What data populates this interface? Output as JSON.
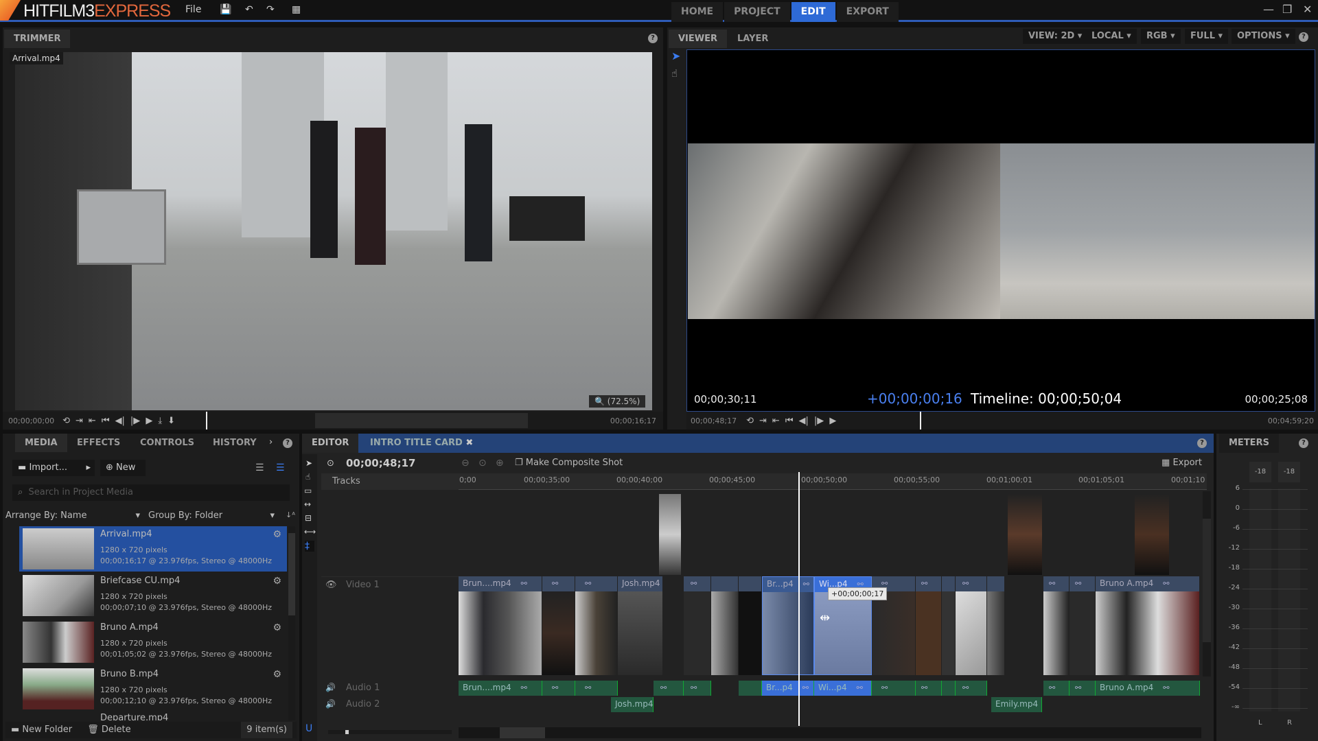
{
  "app": {
    "logo_part1": "HITFILM3",
    "logo_part2": "EXPRESS",
    "menu_file": "File",
    "mode_tabs": [
      "HOME",
      "PROJECT",
      "EDIT",
      "EXPORT"
    ],
    "active_mode": "EDIT",
    "accent": "#2e6ad6"
  },
  "trimmer": {
    "tab": "TRIMMER",
    "clip_label": "Arrival.mp4",
    "zoom": "(72.5%)",
    "timecode_in": "00;00;00;00",
    "timecode_out": "00;00;16;17"
  },
  "viewer": {
    "tabs": [
      "VIEWER",
      "LAYER"
    ],
    "options": [
      "VIEW: 2D",
      "LOCAL",
      "RGB",
      "FULL",
      "OPTIONS"
    ],
    "left_tc": "00;00;30;11",
    "offset": "+00;00;00;16",
    "timeline_tc": "Timeline: 00;00;50;04",
    "right_tc": "00;00;25;08",
    "current_tc": "00;00;48;17",
    "end_tc": "00;04;59;20"
  },
  "media": {
    "tabs": [
      "MEDIA",
      "EFFECTS",
      "CONTROLS",
      "HISTORY"
    ],
    "import_label": "Import...",
    "new_label": "New",
    "search_placeholder": "Search in Project Media",
    "arrange": "Arrange By: Name",
    "group": "Group By: Folder",
    "items": [
      {
        "name": "Arrival.mp4",
        "dims": "1280 x 720 pixels",
        "info": "00;00;16;17 @ 23.976fps, Stereo @ 48000Hz"
      },
      {
        "name": "Briefcase CU.mp4",
        "dims": "1280 x 720 pixels",
        "info": "00;00;07;10 @ 23.976fps, Stereo @ 48000Hz"
      },
      {
        "name": "Bruno A.mp4",
        "dims": "1280 x 720 pixels",
        "info": "00;01;05;02 @ 23.976fps, Stereo @ 48000Hz"
      },
      {
        "name": "Bruno B.mp4",
        "dims": "1280 x 720 pixels",
        "info": "00;00;12;10 @ 23.976fps, Stereo @ 48000Hz"
      },
      {
        "name": "Departure.mp4"
      }
    ],
    "new_folder": "New Folder",
    "delete": "Delete",
    "count": "9 item(s)"
  },
  "editor": {
    "tabs": [
      "EDITOR",
      "INTRO TITLE CARD"
    ],
    "timecode": "00;00;48;17",
    "composite": "Make Composite Shot",
    "export": "Export",
    "tracks_label": "Tracks",
    "ruler": [
      "0;00",
      "00;00;35;00",
      "00;00;40;00",
      "00;00;45;00",
      "00;00;50;00",
      "00;00;55;00",
      "00;01;00;01",
      "00;01;05;01",
      "00;01;10"
    ],
    "video_track": "Video 1",
    "audio_tracks": [
      "Audio 1",
      "Audio 2"
    ],
    "tooltip": "+00;00;00;17",
    "video_clips": [
      "Brun....mp4",
      "Josh.mp4",
      "Br...p4",
      "Wi...p4",
      "Bruno A.mp4"
    ],
    "audio1_clips": [
      "Brun....mp4",
      "Br...p4",
      "Wi...p4",
      "Bruno A.mp4"
    ],
    "audio2_clips": [
      "Josh.mp4",
      "Emily.mp4"
    ]
  },
  "meters": {
    "title": "METERS",
    "peaks": [
      "-18",
      "-18"
    ],
    "scale": [
      "6",
      "0",
      "-6",
      "-12",
      "-18",
      "-24",
      "-30",
      "-36",
      "-42",
      "-48",
      "-54",
      "-∞"
    ],
    "channels": [
      "L",
      "R"
    ]
  }
}
